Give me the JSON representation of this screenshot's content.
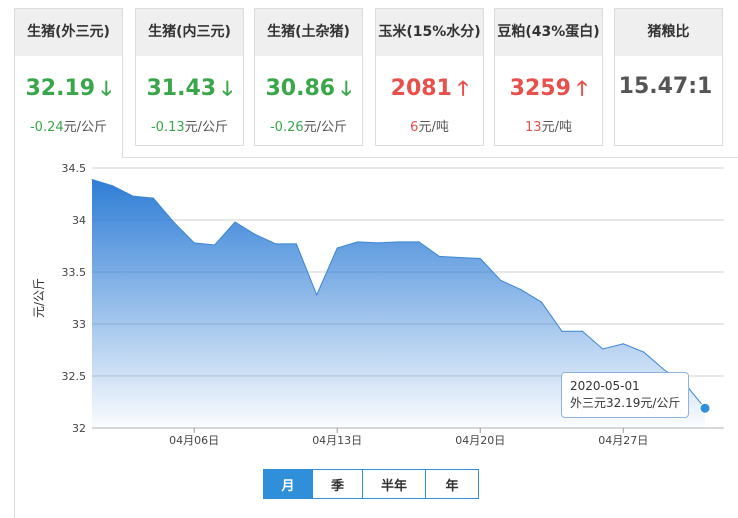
{
  "cards": [
    {
      "title": "生猪(外三元)",
      "price": "32.19",
      "trend": "down",
      "arrow": "🡓",
      "change": "-0.24",
      "unit": "元/公斤"
    },
    {
      "title": "生猪(内三元)",
      "price": "31.43",
      "trend": "down",
      "arrow": "🡓",
      "change": "-0.13",
      "unit": "元/公斤"
    },
    {
      "title": "生猪(土杂猪)",
      "price": "30.86",
      "trend": "down",
      "arrow": "🡓",
      "change": "-0.26",
      "unit": "元/公斤"
    },
    {
      "title": "玉米(15%水分)",
      "price": "2081",
      "trend": "up",
      "arrow": "🡑",
      "change": "6",
      "unit": "元/吨"
    },
    {
      "title": "豆粕(43%蛋白)",
      "price": "3259",
      "trend": "up",
      "arrow": "🡑",
      "change": "13",
      "unit": "元/吨"
    },
    {
      "title": "猪粮比",
      "price": "15.47:1",
      "trend": "neutral",
      "arrow": "",
      "change": "",
      "unit": ""
    }
  ],
  "colors": {
    "down": "#3aa64a",
    "up": "#e8504c",
    "accent": "#2f8fd8",
    "area_top": "#2e7dd6",
    "line": "#3c86d3"
  },
  "tooltip": {
    "date": "2020-05-01",
    "value_text": "外三元32.19元/公斤"
  },
  "range_buttons": [
    {
      "label": "月",
      "active": true
    },
    {
      "label": "季",
      "active": false
    },
    {
      "label": "半年",
      "active": false
    },
    {
      "label": "年",
      "active": false
    }
  ],
  "chart_data": {
    "type": "area",
    "ylabel": "元/公斤",
    "ylim": [
      32,
      34.5
    ],
    "yticks": [
      "32",
      "32.5",
      "33",
      "33.5",
      "34",
      "34.5"
    ],
    "x": [
      "04-01",
      "04-02",
      "04-03",
      "04-04",
      "04-05",
      "04-06",
      "04-07",
      "04-08",
      "04-09",
      "04-10",
      "04-11",
      "04-12",
      "04-13",
      "04-14",
      "04-15",
      "04-16",
      "04-17",
      "04-18",
      "04-19",
      "04-20",
      "04-21",
      "04-22",
      "04-23",
      "04-24",
      "04-25",
      "04-26",
      "04-27",
      "04-28",
      "04-29",
      "04-30",
      "05-01"
    ],
    "xtick_labels": [
      {
        "index": 5,
        "label": "04月06日"
      },
      {
        "index": 12,
        "label": "04月13日"
      },
      {
        "index": 19,
        "label": "04月20日"
      },
      {
        "index": 26,
        "label": "04月27日"
      }
    ],
    "series": [
      {
        "values": [
          34.39,
          34.33,
          34.23,
          34.21,
          33.98,
          33.78,
          33.76,
          33.98,
          33.86,
          33.77,
          33.77,
          33.28,
          33.73,
          33.79,
          33.78,
          33.79,
          33.79,
          33.65,
          33.64,
          33.63,
          33.42,
          33.33,
          33.21,
          32.93,
          32.93,
          32.76,
          32.81,
          32.73,
          32.56,
          32.43,
          32.19
        ]
      }
    ],
    "grid": true
  }
}
